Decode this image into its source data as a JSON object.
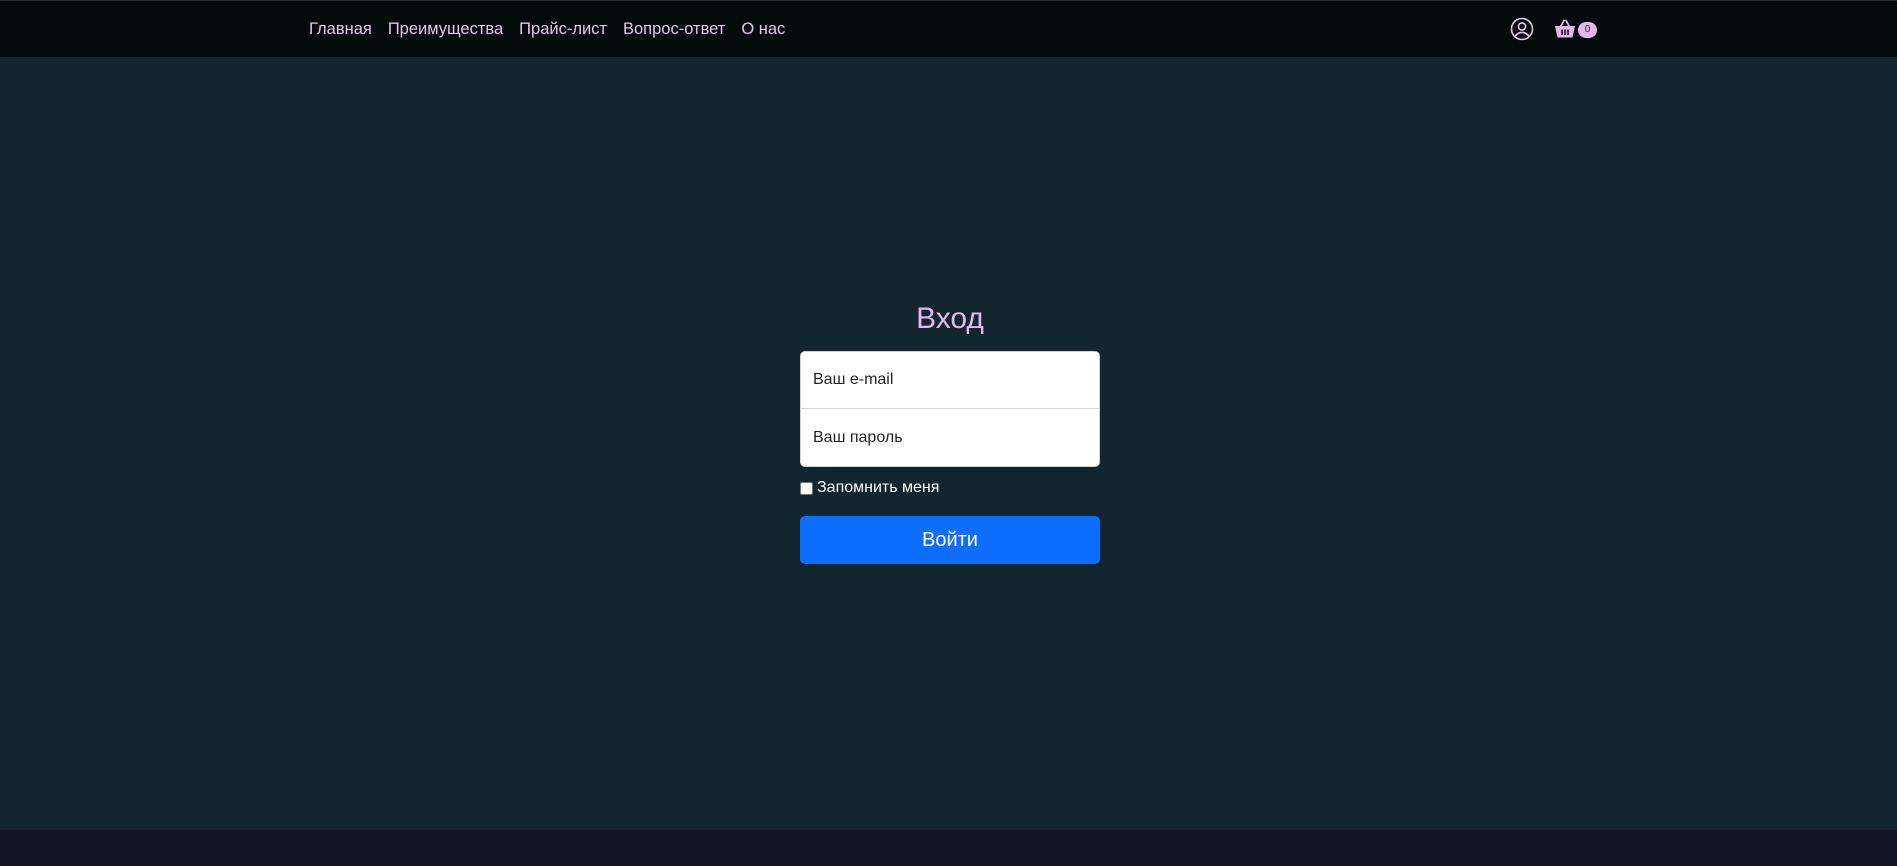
{
  "nav": {
    "links": [
      "Главная",
      "Преимущества",
      "Прайс-лист",
      "Вопрос-ответ",
      "О нас"
    ],
    "cart_count": "0",
    "user_icon": "user-circle-icon",
    "cart_icon": "shopping-basket-icon"
  },
  "login": {
    "title": "Вход",
    "email_placeholder": "Ваш e-mail",
    "password_placeholder": "Ваш пароль",
    "remember_label": "Запомнить меня",
    "remember_checked": false,
    "submit_label": "Войти"
  },
  "colors": {
    "navbar_bg": "#04090b",
    "page_bg": "#12262f",
    "footer_bg": "#111423",
    "accent_pink": "#e7b6ea",
    "button_blue": "#0d6efd"
  }
}
